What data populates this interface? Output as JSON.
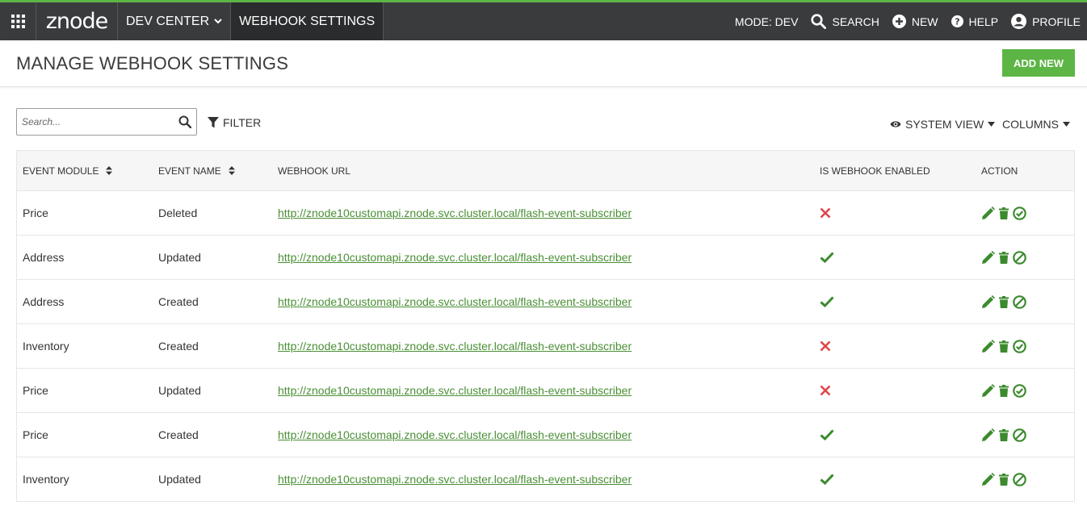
{
  "topbar": {
    "logo": "znode",
    "dev_center": "DEV CENTER",
    "webhook_settings": "WEBHOOK SETTINGS",
    "mode": "MODE: DEV",
    "search": "SEARCH",
    "new": "NEW",
    "help": "HELP",
    "profile": "PROFILE"
  },
  "header": {
    "title": "MANAGE WEBHOOK SETTINGS",
    "add_new": "ADD NEW"
  },
  "toolbar": {
    "search_placeholder": "Search...",
    "filter": "FILTER",
    "system_view": "SYSTEM VIEW",
    "columns": "COLUMNS"
  },
  "table": {
    "headers": [
      "EVENT MODULE",
      "EVENT NAME",
      "WEBHOOK URL",
      "IS WEBHOOK ENABLED",
      "ACTION"
    ],
    "rows": [
      {
        "module": "Price",
        "name": "Deleted",
        "url": "http://znode10customapi.znode.svc.cluster.local/flash-event-subscriber",
        "enabled": false
      },
      {
        "module": "Address",
        "name": "Updated",
        "url": "http://znode10customapi.znode.svc.cluster.local/flash-event-subscriber",
        "enabled": true
      },
      {
        "module": "Address",
        "name": "Created",
        "url": "http://znode10customapi.znode.svc.cluster.local/flash-event-subscriber",
        "enabled": true
      },
      {
        "module": "Inventory",
        "name": "Created",
        "url": "http://znode10customapi.znode.svc.cluster.local/flash-event-subscriber",
        "enabled": false
      },
      {
        "module": "Price",
        "name": "Updated",
        "url": "http://znode10customapi.znode.svc.cluster.local/flash-event-subscriber",
        "enabled": false
      },
      {
        "module": "Price",
        "name": "Created",
        "url": "http://znode10customapi.znode.svc.cluster.local/flash-event-subscriber",
        "enabled": true
      },
      {
        "module": "Inventory",
        "name": "Updated",
        "url": "http://znode10customapi.znode.svc.cluster.local/flash-event-subscriber",
        "enabled": true
      }
    ]
  },
  "colors": {
    "brand_green": "#5cb544",
    "topbar_bg": "#3a3b3d",
    "check_green": "#3c8a2e",
    "cross_red": "#e0474c",
    "link_green": "#4a8f35"
  },
  "icons": {
    "apps": "grid-icon",
    "search": "search-icon",
    "new": "plus-circle-icon",
    "help": "question-circle-icon",
    "profile": "user-circle-icon",
    "filter": "filter-icon",
    "view": "eye-icon",
    "edit": "pencil-icon",
    "delete": "trash-icon",
    "enable": "check-circle-icon",
    "disable": "ban-icon"
  }
}
